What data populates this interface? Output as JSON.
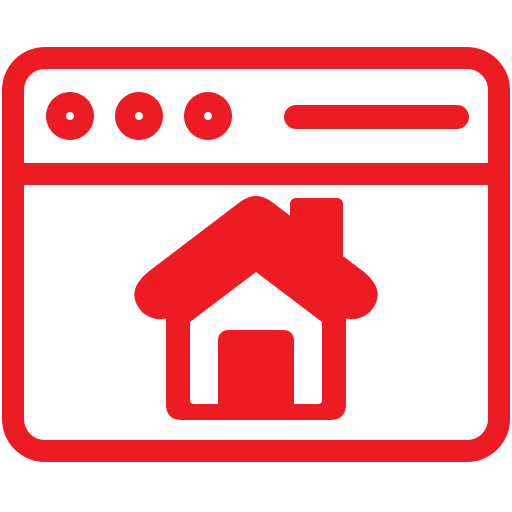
{
  "icon": {
    "name": "browser-home-icon",
    "color": "#ED1C24",
    "background": "#FFFFFF",
    "parts": {
      "window": "browser-window",
      "title_bar_dots": [
        "window-dot",
        "window-dot",
        "window-dot"
      ],
      "address_bar": "address-bar",
      "home": "home-icon",
      "chimney": "chimney",
      "door": "door"
    }
  }
}
